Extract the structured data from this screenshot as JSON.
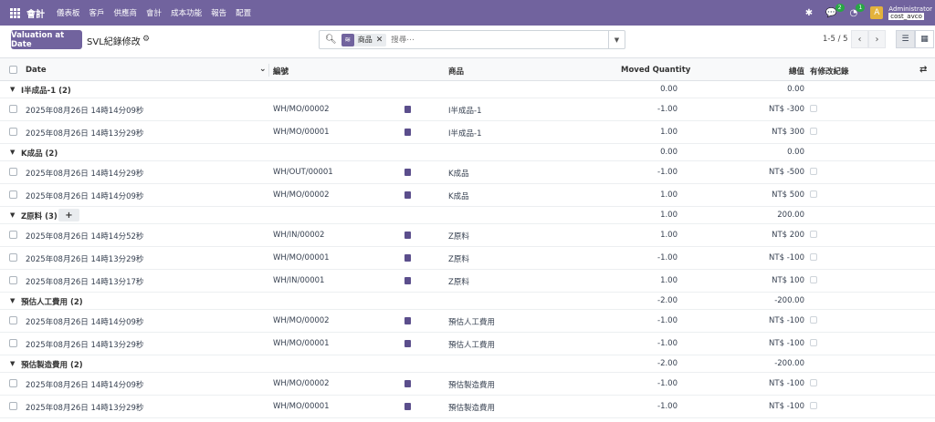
{
  "navbar": {
    "brand": "會計",
    "menu": [
      "儀表板",
      "客戶",
      "供應商",
      "會計",
      "成本功能",
      "報告",
      "配置"
    ],
    "activity_icon": "bug-icon",
    "messages_count": "2",
    "activities_count": "1",
    "avatar_letter": "A",
    "user_name": "Administrator",
    "db_name": "cost_avco"
  },
  "control": {
    "valuation_button": "Valuation at Date",
    "page_title": "SVL紀錄修改",
    "facet_label": "商品",
    "search_placeholder": "搜尋⋯",
    "pager": "1-5 / 5"
  },
  "table": {
    "headers": {
      "date": "Date",
      "reference": "編號",
      "product": "商品",
      "quantity": "Moved Quantity",
      "value": "總值",
      "changed": "有修改紀錄"
    },
    "groups": [
      {
        "name": "I半成品-1 (2)",
        "quantity": "0.00",
        "value": "0.00",
        "add_button": false,
        "rows": [
          {
            "date": "2025年08月26日 14時14分09秒",
            "ref": "WH/MO/00002",
            "product": "I半成品-1",
            "qty": "-1.00",
            "value": "NT$ -300"
          },
          {
            "date": "2025年08月26日 14時13分29秒",
            "ref": "WH/MO/00001",
            "product": "I半成品-1",
            "qty": "1.00",
            "value": "NT$ 300"
          }
        ]
      },
      {
        "name": "K成品 (2)",
        "quantity": "0.00",
        "value": "0.00",
        "add_button": false,
        "rows": [
          {
            "date": "2025年08月26日 14時14分29秒",
            "ref": "WH/OUT/00001",
            "product": "K成品",
            "qty": "-1.00",
            "value": "NT$ -500"
          },
          {
            "date": "2025年08月26日 14時14分09秒",
            "ref": "WH/MO/00002",
            "product": "K成品",
            "qty": "1.00",
            "value": "NT$ 500"
          }
        ]
      },
      {
        "name": "Z原料 (3)",
        "quantity": "1.00",
        "value": "200.00",
        "add_button": true,
        "add_label": "+",
        "rows": [
          {
            "date": "2025年08月26日 14時14分52秒",
            "ref": "WH/IN/00002",
            "product": "Z原料",
            "qty": "1.00",
            "value": "NT$ 200"
          },
          {
            "date": "2025年08月26日 14時13分29秒",
            "ref": "WH/MO/00001",
            "product": "Z原料",
            "qty": "-1.00",
            "value": "NT$ -100"
          },
          {
            "date": "2025年08月26日 14時13分17秒",
            "ref": "WH/IN/00001",
            "product": "Z原料",
            "qty": "1.00",
            "value": "NT$ 100"
          }
        ]
      },
      {
        "name": "預估人工費用 (2)",
        "quantity": "-2.00",
        "value": "-200.00",
        "add_button": false,
        "rows": [
          {
            "date": "2025年08月26日 14時14分09秒",
            "ref": "WH/MO/00002",
            "product": "預估人工費用",
            "qty": "-1.00",
            "value": "NT$ -100"
          },
          {
            "date": "2025年08月26日 14時13分29秒",
            "ref": "WH/MO/00001",
            "product": "預估人工費用",
            "qty": "-1.00",
            "value": "NT$ -100"
          }
        ]
      },
      {
        "name": "預估製造費用 (2)",
        "quantity": "-2.00",
        "value": "-200.00",
        "add_button": false,
        "rows": [
          {
            "date": "2025年08月26日 14時14分09秒",
            "ref": "WH/MO/00002",
            "product": "預估製造費用",
            "qty": "-1.00",
            "value": "NT$ -100"
          },
          {
            "date": "2025年08月26日 14時13分29秒",
            "ref": "WH/MO/00001",
            "product": "預估製造費用",
            "qty": "-1.00",
            "value": "NT$ -100"
          }
        ]
      }
    ]
  }
}
